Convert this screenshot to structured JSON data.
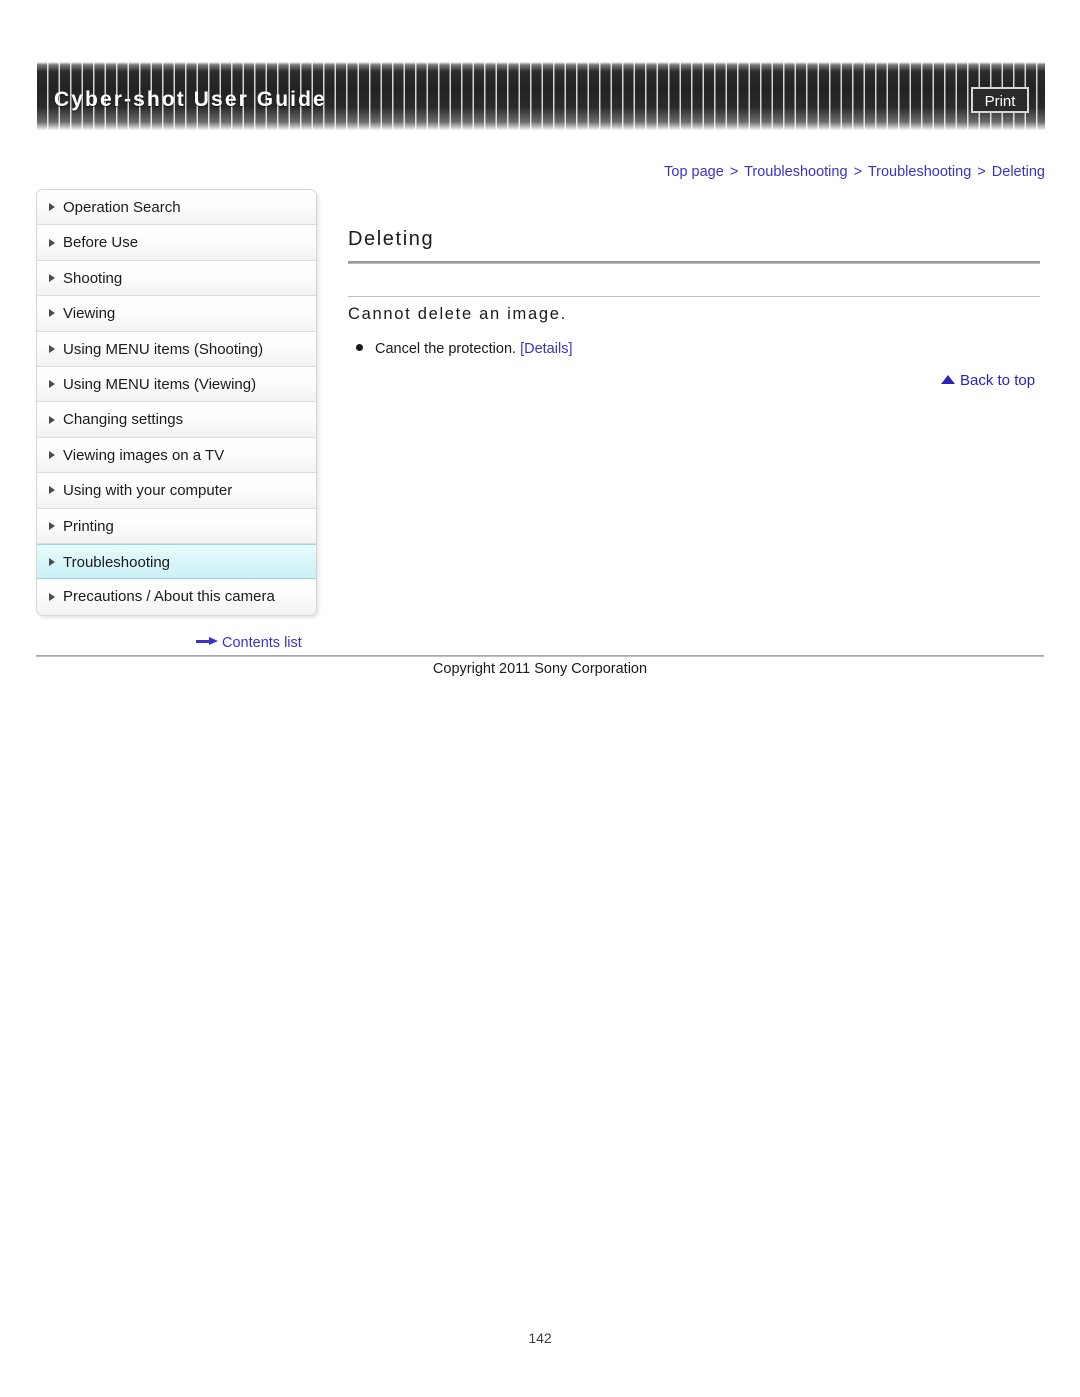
{
  "header": {
    "title": "Cyber-shot User Guide",
    "print_label": "Print"
  },
  "breadcrumb": {
    "separator": ">",
    "items": [
      {
        "label": "Top page"
      },
      {
        "label": "Troubleshooting"
      },
      {
        "label": "Troubleshooting"
      },
      {
        "label": "Deleting"
      }
    ]
  },
  "sidebar": {
    "items": [
      {
        "label": "Operation Search",
        "active": false
      },
      {
        "label": "Before Use",
        "active": false
      },
      {
        "label": "Shooting",
        "active": false
      },
      {
        "label": "Viewing",
        "active": false
      },
      {
        "label": "Using MENU items (Shooting)",
        "active": false
      },
      {
        "label": "Using MENU items (Viewing)",
        "active": false
      },
      {
        "label": "Changing settings",
        "active": false
      },
      {
        "label": "Viewing images on a TV",
        "active": false
      },
      {
        "label": "Using with your computer",
        "active": false
      },
      {
        "label": "Printing",
        "active": false
      },
      {
        "label": "Troubleshooting",
        "active": true
      },
      {
        "label": "Precautions / About this camera",
        "active": false
      }
    ],
    "contents_link": "Contents list"
  },
  "main": {
    "title": "Deleting",
    "section_heading": "Cannot delete an image.",
    "bullets": [
      {
        "text": "Cancel the protection.",
        "link_label": "[Details]"
      }
    ],
    "back_to_top": "Back to top"
  },
  "footer": {
    "copyright": "Copyright 2011 Sony Corporation",
    "page_number": "142"
  },
  "colors": {
    "link": "#3b32c8",
    "active_nav_bg": "#d7f5f8",
    "active_nav_border": "#8fd9e6",
    "banner_dark": "#232323",
    "text": "#1a1a1a"
  }
}
